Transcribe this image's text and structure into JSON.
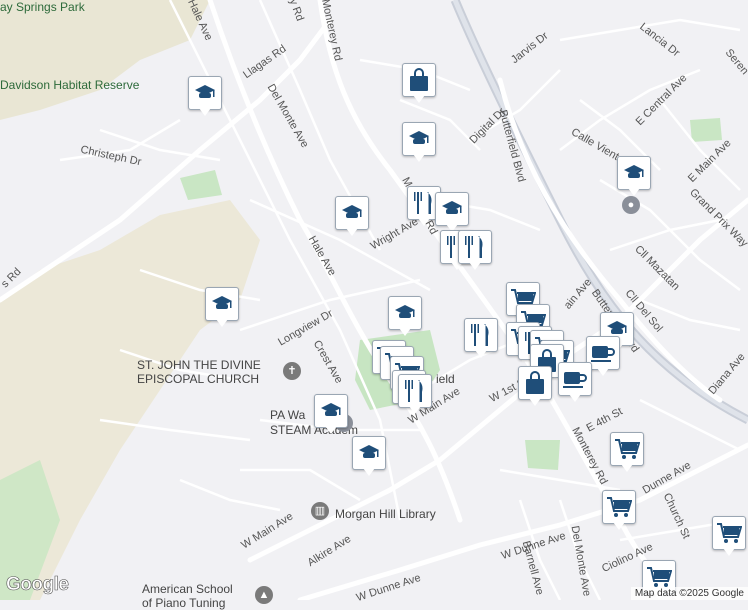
{
  "map": {
    "attribution": "Map data ©2025 Google",
    "logo": "Google",
    "places": {
      "springs_park": "ay Springs Park",
      "habitat_reserve": "Davidson Habitat Reserve",
      "church_line1": "ST. JOHN THE DIVINE",
      "church_line2": "EPISCOPAL CHURCH",
      "pa_walnut_line1": "PA Wa",
      "pa_walnut_line2": "STEAM Academ",
      "library": "Morgan Hill Library",
      "american_school_line1": "American School",
      "american_school_line2": "of Piano Tuning",
      "field_fragment": "ield"
    },
    "streets": {
      "llagas": "Llagas Rd",
      "del_monte_top": "Del Monte Ave",
      "monterey_top": "Monterey Rd",
      "hale_top": "Hale Ave",
      "christeph": "Christeph Dr",
      "hale": "Hale Ave",
      "wright": "Wright Ave",
      "longview": "Longview Dr",
      "crest": "Crest Ave",
      "w_main_1": "W Main Ave",
      "w_main_2": "W Main Ave",
      "alkire": "Alkire Ave",
      "w_dunne_1": "W Dunne Ave",
      "w_dunne_2": "W Dunne Ave",
      "barnell": "Barnell Ave",
      "del_monte_bottom": "Del Monte Ave",
      "monterey_bottom": "Monterey Rd",
      "e_dunne": "Dunne Ave",
      "church_st": "Church St",
      "ciolino": "Ciolino Ave",
      "e_4th": "E 4th St",
      "w_1st": "W 1st St",
      "butterfield": "Butterfield Blvd",
      "butterfield_2": "Butterfield Blvd",
      "digital": "Digital Dr",
      "jarvis": "Jarvis Dr",
      "calle_viento": "Calle Viento",
      "e_central": "E Central Ave",
      "e_main": "E Main Ave",
      "grand_prix": "Grand Prix Way",
      "cll_mazatan": "Cll Mazatan",
      "cll_del_sol": "Cll Del Sol",
      "lancia": "Lancia Dr",
      "serene": "Seren",
      "diana": "Diana Ave",
      "main_ave_mid": "ain Ave",
      "monterey_mid": "Monterey Rd",
      "rd_left": "s Rd",
      "dr_top": "y Rd"
    },
    "marker_icons": {
      "school": "graduation-cap-icon",
      "restaurant": "fork-knife-icon",
      "shopping": "shopping-bag-icon",
      "grocery": "shopping-cart-icon",
      "cafe": "coffee-cup-icon"
    },
    "colors": {
      "marker_blue": "#1f4e79",
      "land": "#f1f1f4",
      "hills": "#e8e4d3",
      "park": "#c9e6c4",
      "road": "#ffffff",
      "highway": "#c8cdd6"
    }
  }
}
